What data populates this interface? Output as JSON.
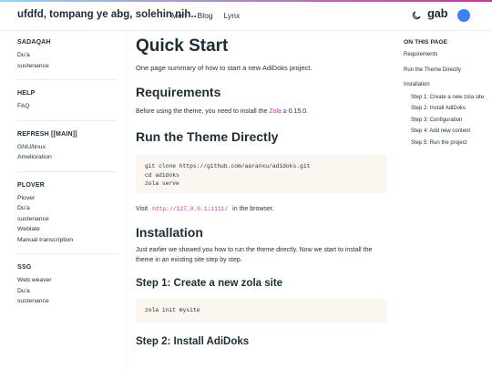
{
  "header": {
    "brand": "ufdfd, tompang ye abg, solehin nih..",
    "nav": [
      "Men",
      "Blog",
      "Lynx"
    ],
    "logo_text": "gab",
    "theme_icon": "moon-icon",
    "accent": "#d32e9d"
  },
  "sidebar": {
    "sections": [
      {
        "title": "SADAQAH",
        "items": [
          "Du'a",
          "sustenance"
        ]
      },
      {
        "title": "HELP",
        "items": [
          "FAQ"
        ]
      },
      {
        "title": "REFRESH [[MAIN]]",
        "items": [
          "GNU/linux",
          "Amelioration"
        ]
      },
      {
        "title": "PLOVER",
        "items": [
          "Plover",
          "Du'a",
          "sustenance",
          "Weblate",
          "Manual transcription"
        ]
      },
      {
        "title": "SSG",
        "items": [
          "Web weaver",
          "Du'a",
          "sustenance"
        ]
      }
    ]
  },
  "main": {
    "title": "Quick Start",
    "lead": "One page summary of how to start a new AdiDoks project.",
    "requirements": {
      "heading": "Requirements",
      "text_before": "Before using the theme, you need to install the",
      "link": "Zola",
      "text_after": "≥ 0.15.0."
    },
    "run": {
      "heading": "Run the Theme Directly",
      "code": "git clone https://github.com/aaranxu/adidoks.git\ncd adidoks\nzola serve",
      "visit_before": "Visit",
      "url": "http://127.0.0.1:1111/",
      "visit_after": "in the browser."
    },
    "installation": {
      "heading": "Installation",
      "text": "Just earlier we showed you how to run the theme directly. Now we start to install the theme in an existing site step by step."
    },
    "step1": {
      "heading": "Step 1: Create a new zola site",
      "code": "zola init mysite"
    },
    "step2": {
      "heading": "Step 2: Install AdiDoks"
    }
  },
  "toc": {
    "title": "ON THIS PAGE",
    "items": [
      "Requirements",
      "Run the Theme Directly",
      "Installation"
    ],
    "subitems": [
      "Step 1: Create a new zola site",
      "Step 2: Install AdiDoks",
      "Step 3: Configuration",
      "Step 4: Add new content",
      "Step 5: Run the project"
    ]
  }
}
